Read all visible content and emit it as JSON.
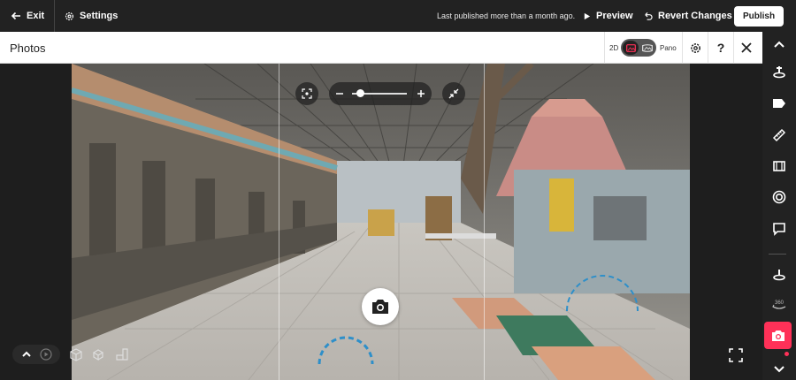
{
  "topbar": {
    "exit_label": "Exit",
    "settings_label": "Settings",
    "last_published": "Last published more than a month ago.",
    "preview_label": "Preview",
    "revert_label": "Revert Changes",
    "publish_label": "Publish"
  },
  "panel": {
    "title": "Photos",
    "mode_2d": "2D",
    "mode_pano": "Pano",
    "help_label": "?"
  },
  "colors": {
    "accent": "#ff3158",
    "topbar_bg": "#222222",
    "panel_bg": "#ffffff"
  },
  "rightbar": {
    "icons": [
      "chevron-up-icon",
      "tool-marker-icon",
      "tag-icon",
      "measure-icon",
      "film-icon",
      "target-icon",
      "comment-icon",
      "floor-icon",
      "pano-360-icon",
      "camera-icon",
      "chevron-down-icon"
    ],
    "pano_label": "360"
  },
  "viewer": {
    "zoom_level": 0.15
  }
}
